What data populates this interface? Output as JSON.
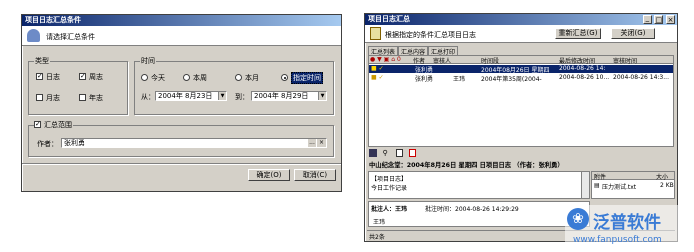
{
  "left": {
    "title": "项目日志汇总条件",
    "header_prompt": "请选择汇总条件",
    "type_group": {
      "label": "类型",
      "daily": "日志",
      "weekly": "周志",
      "monthly": "月志",
      "yearly": "年志"
    },
    "time_group": {
      "label": "时间",
      "today": "今天",
      "this_week": "本周",
      "this_month": "本月",
      "custom": "指定时间",
      "from_label": "从：",
      "from_value": "2004年 8月23日",
      "to_label": "到：",
      "to_value": "2004年 8月29日"
    },
    "scope_group": {
      "label": "汇总范围",
      "author_label": "作者：",
      "author_value": "张利勇",
      "ellipsis": "...",
      "clear": "×"
    },
    "ok": "确定(O)",
    "cancel": "取消(C)"
  },
  "right": {
    "title": "项目日志汇总",
    "header_prompt": "根据指定的条件汇总项目日志",
    "regen": "重新汇总(G)",
    "close": "关闭(G)",
    "tabs": [
      "汇总列表",
      "汇总内容",
      "汇总打印"
    ],
    "columns": [
      "作者",
      "审核人",
      "时间段",
      "最后修改时间",
      "审核时间"
    ],
    "rows": [
      {
        "author": "张利勇",
        "reviewer": "",
        "period": "2004年08月26日 星期四",
        "modified": "2004-08-26 14:",
        "reviewed": ""
      },
      {
        "author": "张利勇",
        "reviewer": "王玮",
        "period": "2004年第35周(2004-",
        "modified": "2004-08-26 10...",
        "reviewed": "2004-08-26 14:3..."
      }
    ],
    "summary_heading": "中山纪念堂：2004年8月26日 星期四 日项目日志 （作者：张利勇）",
    "content_title": "【项目日志】",
    "content_body": "今日工作记录",
    "attach_header": "附件",
    "attach_size_header": "大小",
    "attachment": "压力测试.txt",
    "attachment_size": "2 KB",
    "approver_label": "批注人：王玮",
    "approve_time_label": "批注时间：2004-08-26 14:29:29",
    "approver_note": "王玮",
    "status": "共2条"
  },
  "watermark": {
    "brand": "泛普软件",
    "url": "www.fanpusoft.com"
  }
}
